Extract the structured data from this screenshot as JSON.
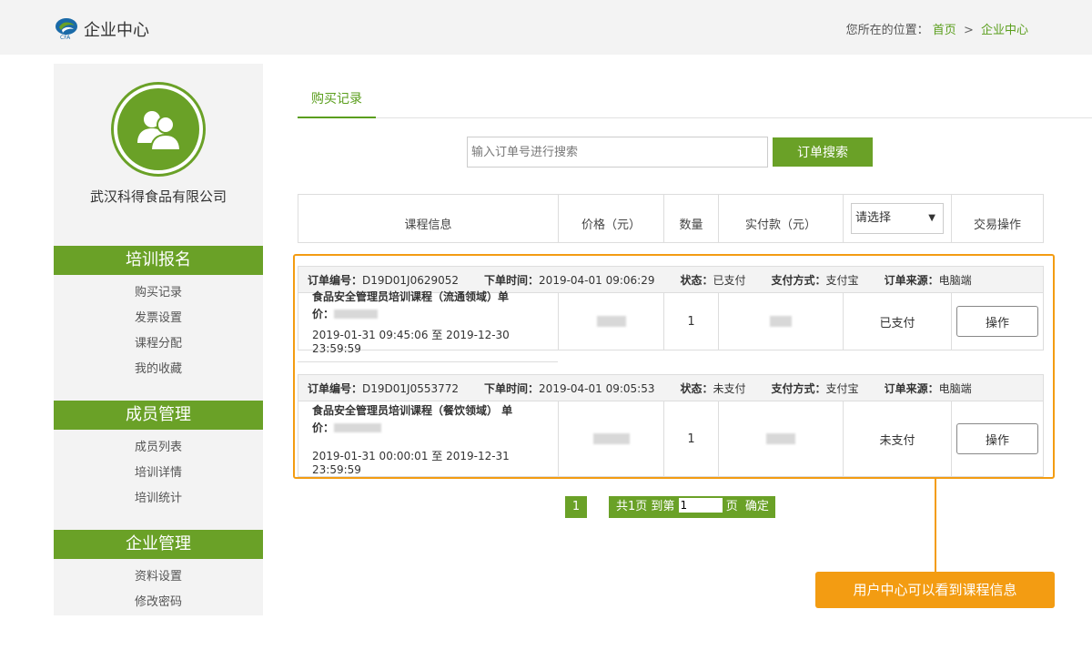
{
  "header": {
    "brand": "企业中心",
    "breadcrumb_prefix": "您所在的位置：",
    "breadcrumb_home": "首页",
    "breadcrumb_sep": ">",
    "breadcrumb_current": "企业中心",
    "accent_color": "#6aa127"
  },
  "sidebar": {
    "company": "武汉科得食品有限公司",
    "sections": [
      {
        "title": "培训报名",
        "items": [
          "购买记录",
          "发票设置",
          "课程分配",
          "我的收藏"
        ]
      },
      {
        "title": "成员管理",
        "items": [
          "成员列表",
          "培训详情",
          "培训统计"
        ]
      },
      {
        "title": "企业管理",
        "items": [
          "资料设置",
          "修改密码"
        ]
      }
    ]
  },
  "tabs": {
    "active": "购买记录"
  },
  "search": {
    "placeholder": "输入订单号进行搜索",
    "button": "订单搜索"
  },
  "table": {
    "headers": [
      "课程信息",
      "价格（元）",
      "数量",
      "实付款（元）",
      "",
      "交易操作"
    ],
    "status_select": "请选择"
  },
  "orders": [
    {
      "order_no_label": "订单编号：",
      "order_no": "D19D01J0629052",
      "time_label": "下单时间：",
      "time": "2019-04-01 09:06:29",
      "status_label": "状态：",
      "status": "已支付",
      "pay_label": "支付方式：",
      "pay": "支付宝",
      "source_label": "订单来源：",
      "source": "电脑端",
      "course_name": "食品安全管理员培训课程（流通领域）单",
      "price_label": "价：",
      "validity": "2019-01-31 09:45:06 至 2019-12-30 23:59:59",
      "qty": "1",
      "row_status": "已支付",
      "action": "操作"
    },
    {
      "order_no_label": "订单编号：",
      "order_no": "D19D01J0553772",
      "time_label": "下单时间：",
      "time": "2019-04-01 09:05:53",
      "status_label": "状态：",
      "status": "未支付",
      "pay_label": "支付方式：",
      "pay": "支付宝",
      "source_label": "订单来源：",
      "source": "电脑端",
      "course_name": "食品安全管理员培训课程（餐饮领域） 单",
      "price_label": "价：",
      "validity": "2019-01-31 00:00:01 至 2019-12-31 23:59:59",
      "qty": "1",
      "row_status": "未支付",
      "action": "操作"
    }
  ],
  "pager": {
    "current": "1",
    "total_text": "共1页 到第",
    "input_value": "1",
    "page_unit": "页",
    "confirm": "确定"
  },
  "callout": {
    "text": "用户中心可以看到课程信息",
    "color": "#f39c12"
  }
}
